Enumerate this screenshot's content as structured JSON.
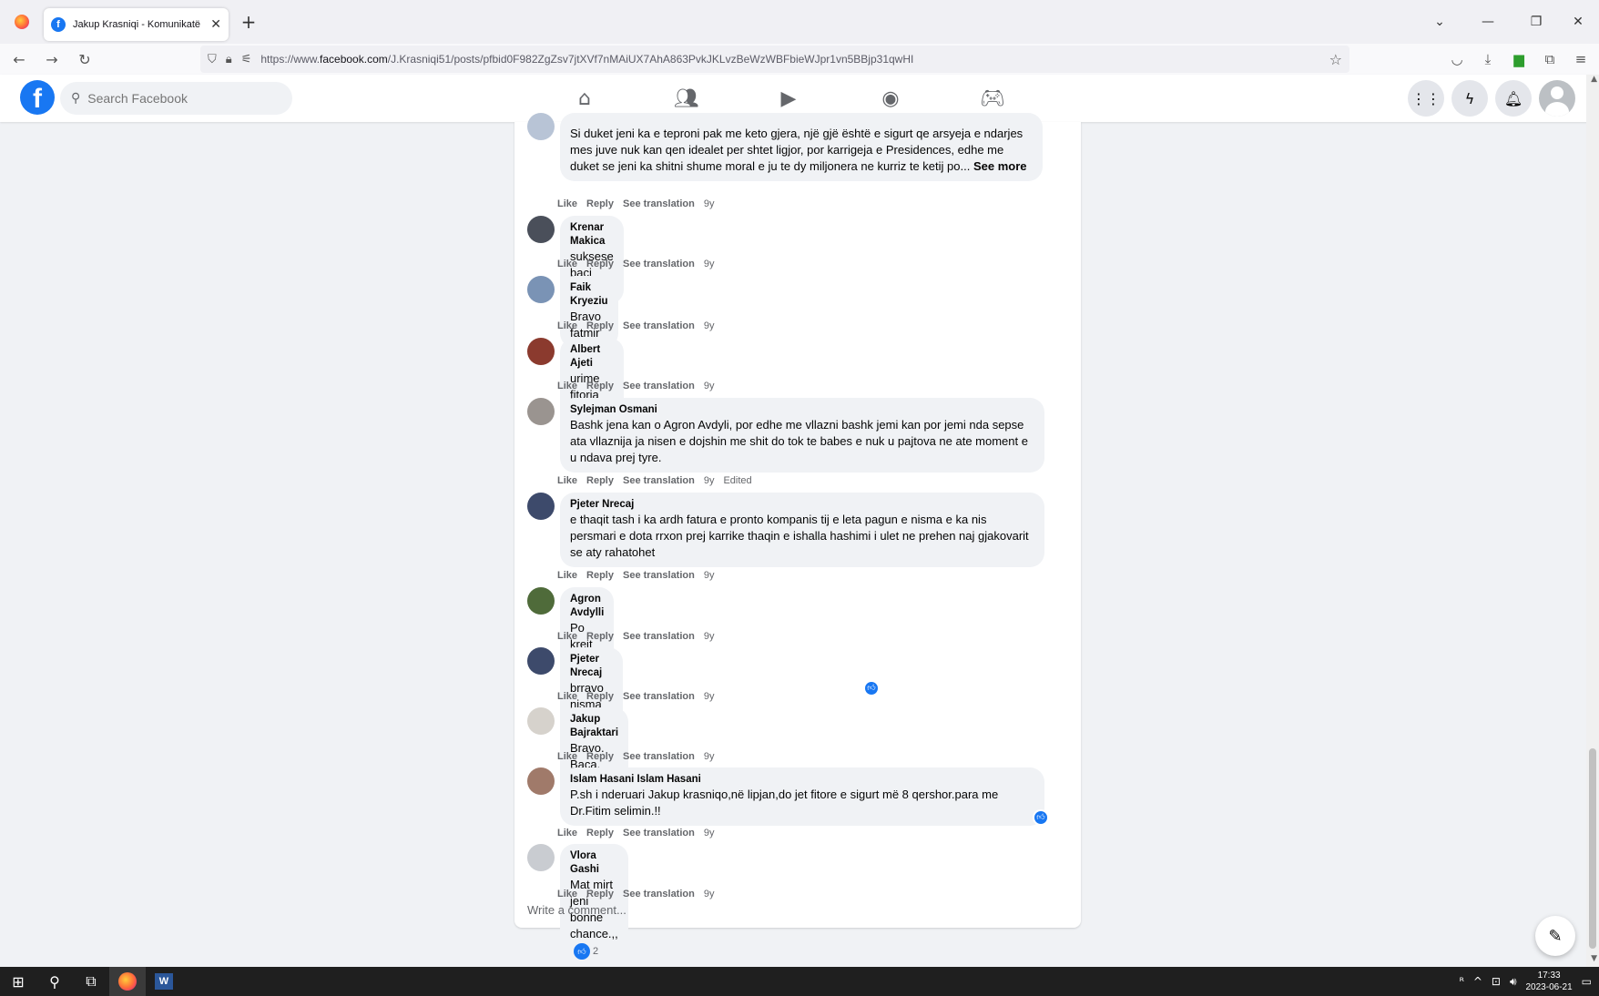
{
  "browser": {
    "tab_title": "Jakup Krasniqi - Komunikatë Te",
    "url_prefix": "https://www.",
    "url_host": "facebook.com",
    "url_path": "/J.Krasniqi51/posts/pfbid0F982ZgZsv7jtXVf7nMAiUX7AhA863PvkJKLvzBeWzWBFbieWJpr1vn5BBjp31qwHI"
  },
  "facebook": {
    "logo": "f",
    "search_placeholder": "Search Facebook"
  },
  "comments": [
    {
      "name": "",
      "text": "Si duket jeni ka e teproni pak me keto gjera, një gjë është e sigurt qe arsyeja e ndarjes mes juve nuk kan qen idealet per shtet ligjor, por karrigeja e Presidences, edhe me duket se jeni ka shitni shume moral e ju te dy miljonera ne kurriz te ketij po...",
      "see_more": "See more",
      "like": "Like",
      "reply": "Reply",
      "translate": "See translation",
      "time": "9y"
    },
    {
      "name": "Krenar Makica",
      "text": "suksese baci jakup",
      "like": "Like",
      "reply": "Reply",
      "translate": "See translation",
      "time": "9y"
    },
    {
      "name": "Faik Kryeziu",
      "text": "Bravo fatmir",
      "like": "Like",
      "reply": "Reply",
      "translate": "See translation",
      "time": "9y"
    },
    {
      "name": "Albert Ajeti",
      "text": "urime fitorja suksese jeni me te miret",
      "like": "Like",
      "reply": "Reply",
      "translate": "See translation",
      "time": "9y"
    },
    {
      "name": "Sylejman Osmani",
      "text": "Bashk jena kan o Agron Avdyli, por edhe me vllazni bashk jemi kan por jemi nda sepse ata vllaznija ja nisen e dojshin me shit do tok te babes e nuk u pajtova ne ate moment e u ndava prej tyre.",
      "like": "Like",
      "reply": "Reply",
      "translate": "See translation",
      "time": "9y",
      "edited": "Edited"
    },
    {
      "name": "Pjeter Nrecaj",
      "text": "e thaqit tash i ka ardh fatura e pronto kompanis tij e leta pagun e nisma e ka nis persmari e dota rrxon prej karrike thaqin e ishalla hashimi i ulet ne prehen naj gjakovarit se aty rahatohet",
      "like": "Like",
      "reply": "Reply",
      "translate": "See translation",
      "time": "9y"
    },
    {
      "name": "Agron Avdylli",
      "text": "Po krejt ne rregull po deri dje a jeni kan bashk ju ?!",
      "like": "Like",
      "reply": "Reply",
      "translate": "See translation",
      "time": "9y"
    },
    {
      "name": "Pjeter Nrecaj",
      "text": "brravo nisma ju lumt veq perpara gjdo rrespekt per ju",
      "like": "Like",
      "reply": "Reply",
      "translate": "See translation",
      "time": "9y"
    },
    {
      "name": "Jakup Bajraktari",
      "text": "Bravo. Baca. Kup",
      "like": "Like",
      "reply": "Reply",
      "translate": "See translation",
      "time": "9y"
    },
    {
      "name": "Islam Hasani Islam Hasani",
      "text": "P.sh i nderuari Jakup krasniqo,në lipjan,do jet fitore e sigurt më 8 qershor.para me Dr.Fitim selimin.!!",
      "like": "Like",
      "reply": "Reply",
      "translate": "See translation",
      "time": "9y"
    },
    {
      "name": "Vlora Gashi",
      "text": "Mat mirt jeni bonne chance.,,",
      "reactions": "2",
      "like": "Like",
      "reply": "Reply",
      "translate": "See translation",
      "time": "9y"
    }
  ],
  "write_comment": "Write a comment...",
  "taskbar": {
    "time": "17:33",
    "date": "2023-06-21"
  }
}
